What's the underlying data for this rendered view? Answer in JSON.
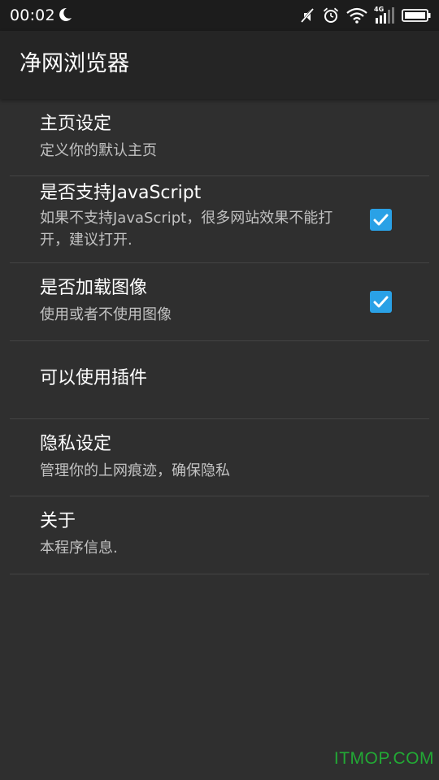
{
  "status_bar": {
    "time": "00:02",
    "network_type": "4G",
    "icons": [
      "moon-icon",
      "mute-icon",
      "alarm-icon",
      "wifi-icon",
      "signal-icon",
      "battery-icon"
    ]
  },
  "app_bar": {
    "title": "净网浏览器"
  },
  "settings": [
    {
      "title": "主页设定",
      "summary": "定义你的默认主页",
      "checked": null
    },
    {
      "title": "是否支持JavaScript",
      "summary": "如果不支持JavaScript，很多网站效果不能打开，建议打开.",
      "checked": true
    },
    {
      "title": "是否加载图像",
      "summary": "使用或者不使用图像",
      "checked": true
    },
    {
      "title": "可以使用插件",
      "summary": "",
      "checked": null
    },
    {
      "title": "隐私设定",
      "summary": "管理你的上网痕迹，确保隐私",
      "checked": null
    },
    {
      "title": "关于",
      "summary": "本程序信息.",
      "checked": null
    }
  ],
  "watermark": "ITMOP.COM",
  "colors": {
    "background": "#2f2f2f",
    "app_bar": "#252525",
    "status_bar": "#1c1c1c",
    "checkbox": "#2aa1e6",
    "divider": "#444444",
    "summary_text": "#c2c2c2",
    "watermark": "#22a935"
  }
}
